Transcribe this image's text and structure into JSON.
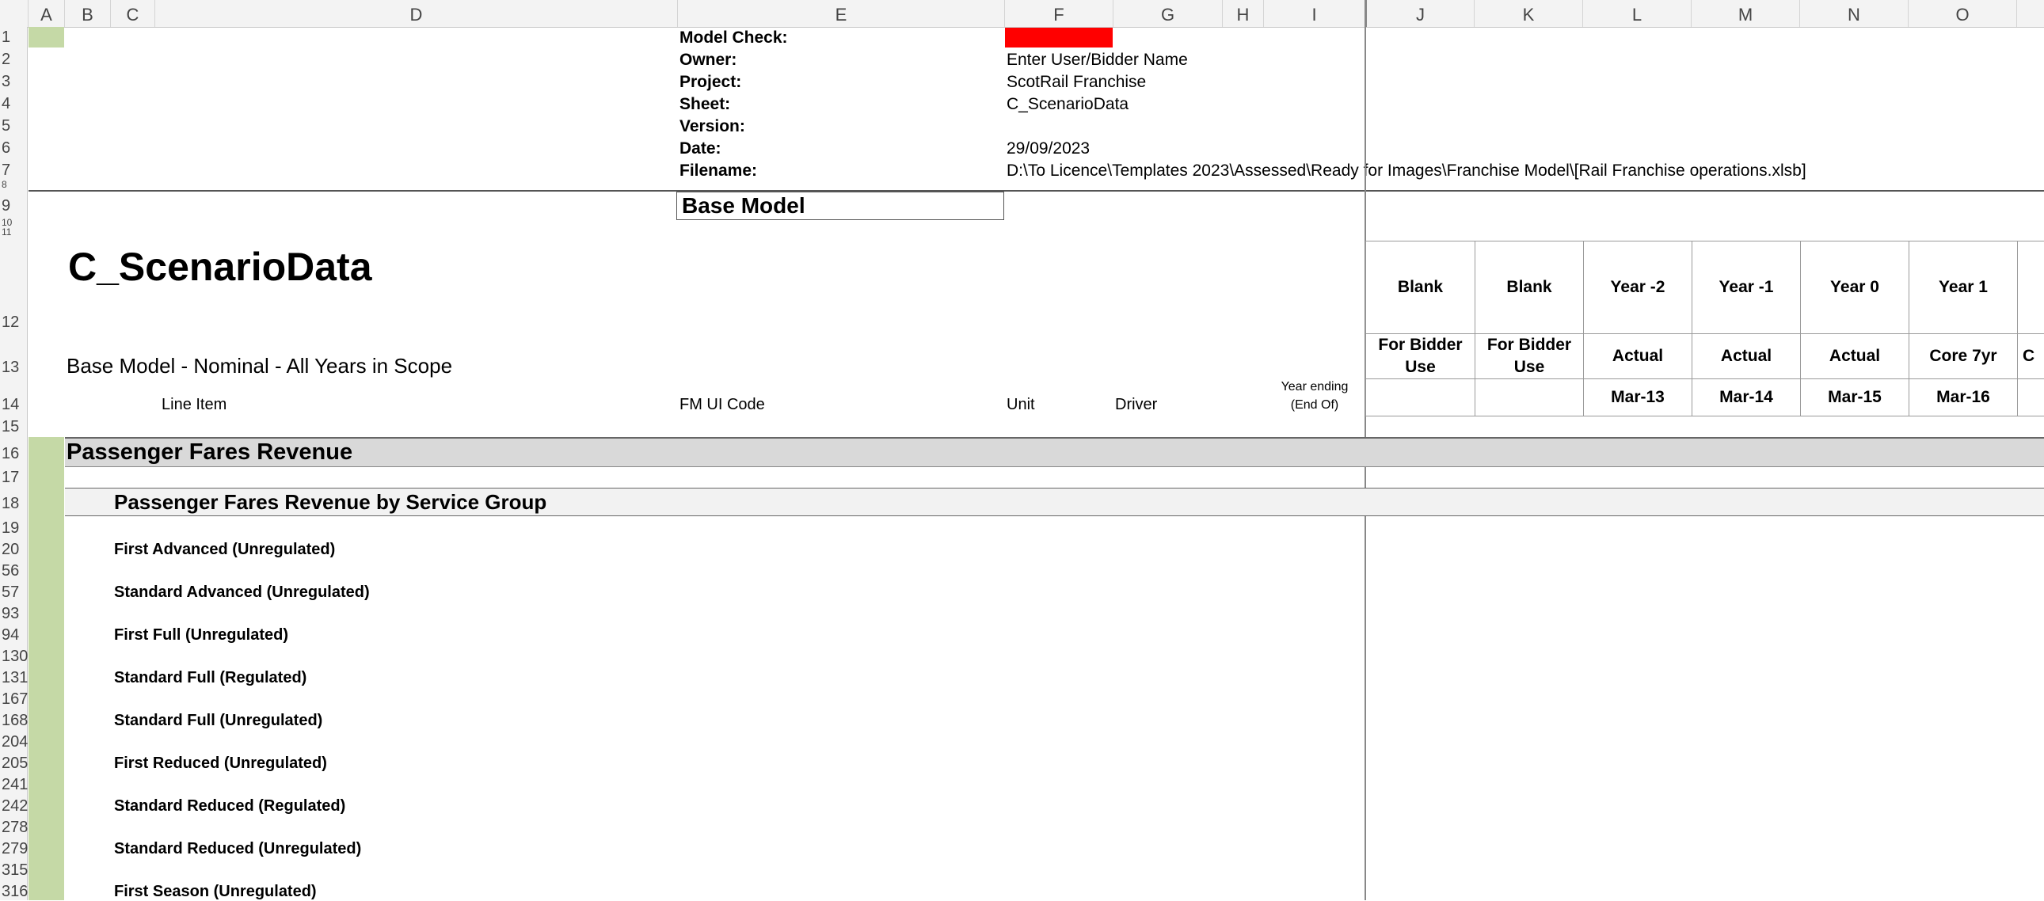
{
  "columns": [
    "A",
    "B",
    "C",
    "D",
    "E",
    "F",
    "G",
    "H",
    "I",
    "J",
    "K",
    "L",
    "M",
    "N",
    "O"
  ],
  "rows": [
    "1",
    "2",
    "3",
    "4",
    "5",
    "6",
    "7",
    "8",
    "9",
    "10",
    "11",
    "12",
    "13",
    "14",
    "15",
    "16",
    "17",
    "18",
    "19",
    "20",
    "56",
    "57",
    "93",
    "94",
    "130",
    "131",
    "167",
    "168",
    "204",
    "205",
    "241",
    "242",
    "278",
    "279",
    "315",
    "316"
  ],
  "header_info": {
    "model_check_label": "Model Check:",
    "owner_label": "Owner:",
    "owner_value": "Enter User/Bidder Name",
    "project_label": "Project:",
    "project_value": "ScotRail Franchise",
    "sheet_label": "Sheet:",
    "sheet_value": "C_ScenarioData",
    "version_label": "Version:",
    "date_label": "Date:",
    "date_value": "29/09/2023",
    "filename_label": "Filename:",
    "filename_value": "D:\\To Licence\\Templates 2023\\Assessed\\Ready for Images\\Franchise Model\\[Rail Franchise operations.xlsb]",
    "model_check_color": "#ff0000"
  },
  "base_model_box": "Base Model",
  "sheet_title": "C_ScenarioData",
  "sheet_subtitle": "Base Model - Nominal - All Years in Scope",
  "col_titles": {
    "line_item": "Line Item",
    "fm_ui_code": "FM UI Code",
    "unit": "Unit",
    "driver": "Driver",
    "year_ending": "Year ending",
    "end_of": "(End Of)"
  },
  "year_columns": [
    {
      "top": "Blank",
      "mid": "For Bidder Use",
      "bottom": ""
    },
    {
      "top": "Blank",
      "mid": "For Bidder Use",
      "bottom": ""
    },
    {
      "top": "Year -2",
      "mid": "Actual",
      "bottom": "Mar-13"
    },
    {
      "top": "Year -1",
      "mid": "Actual",
      "bottom": "Mar-14"
    },
    {
      "top": "Year 0",
      "mid": "Actual",
      "bottom": "Mar-15"
    },
    {
      "top": "Year 1",
      "mid": "Core 7yr",
      "bottom": "Mar-16"
    },
    {
      "top": "",
      "mid": "C",
      "bottom": ""
    }
  ],
  "section_title": "Passenger Fares Revenue",
  "subsection_title": "Passenger Fares Revenue by Service Group",
  "line_items": [
    "First Advanced (Unregulated)",
    "Standard Advanced (Unregulated)",
    "First Full (Unregulated)",
    "Standard Full (Regulated)",
    "Standard Full (Unregulated)",
    "First Reduced (Unregulated)",
    "Standard Reduced (Regulated)",
    "Standard Reduced (Unregulated)",
    "First Season (Unregulated)"
  ],
  "colors": {
    "row_marker_green": "#c5d9a6",
    "section_band": "#d9d9d9",
    "subsection_band": "#f2f2f2",
    "header_gray": "#f3f3f3"
  }
}
